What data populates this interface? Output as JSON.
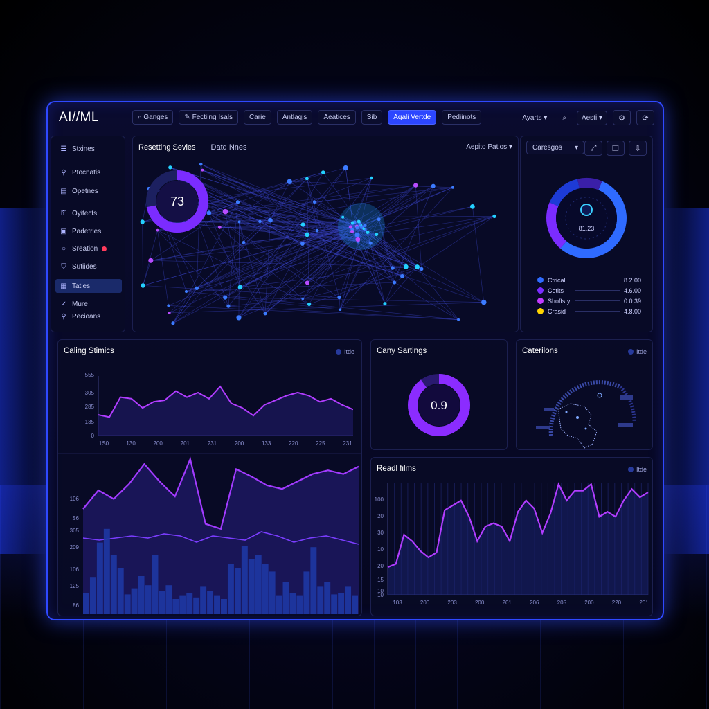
{
  "app": {
    "title": "AI//ML"
  },
  "nav": [
    {
      "label": "Ganges",
      "icon": "search-icon"
    },
    {
      "label": "Fectiing Isals",
      "icon": "pen-icon"
    },
    {
      "label": "Carie"
    },
    {
      "label": "Antlagjs"
    },
    {
      "label": "Aeatices"
    },
    {
      "label": "Sib"
    },
    {
      "label": "Aqali Vertde",
      "active": true
    },
    {
      "label": "Pediinots"
    }
  ],
  "top_right": {
    "user": "Ayarts",
    "menu": "Aesti"
  },
  "sidebar": {
    "items": [
      {
        "label": "Stxines",
        "icon": "menu-icon"
      },
      {
        "label": "Ptocnatis",
        "icon": "wand-icon"
      },
      {
        "label": "Opetnes",
        "icon": "calendar-icon"
      },
      {
        "label": "Oyitects",
        "icon": "lock-icon"
      },
      {
        "label": "Padetries",
        "icon": "folder-icon"
      },
      {
        "label": "Sreation",
        "icon": "circle-icon",
        "alert": true
      },
      {
        "label": "Sutiides",
        "icon": "shield-icon"
      },
      {
        "label": "Tatles",
        "icon": "table-icon",
        "active": true
      },
      {
        "label": "Mure",
        "icon": "check-icon"
      },
      {
        "label": "Pecioans",
        "icon": "wand-icon"
      }
    ]
  },
  "network_panel": {
    "tabs": [
      "Resetting Sevies",
      "Datd Nnes"
    ],
    "dropdown": "Aepito Patios",
    "gauge_value": "73",
    "gauge_fraction": 0.72
  },
  "donut_panel": {
    "dropdown": "Caresgos",
    "center_text": "81.23",
    "legend": [
      {
        "label": "Ctrical",
        "value": "8.2.00",
        "color": "#2f6bff"
      },
      {
        "label": "Cetits",
        "value": "4.6.00",
        "color": "#7b2cff"
      },
      {
        "label": "Shoffsty",
        "value": "0.0.39",
        "color": "#c23bff"
      },
      {
        "label": "Crasid",
        "value": "4.8.00",
        "color": "#ffd400"
      }
    ],
    "slices": [
      0.55,
      0.2,
      0.15,
      0.1
    ]
  },
  "calling": {
    "title": "Caling Stimics",
    "legend": "Itde",
    "y_ticks": [
      "0",
      "135",
      "285",
      "305",
      "555"
    ],
    "x_ticks": [
      "1S0",
      "130",
      "200",
      "201",
      "231",
      "200",
      "133",
      "220",
      "225",
      "231"
    ]
  },
  "big_chart": {
    "y_ticks": [
      "106",
      "S6",
      "305",
      "209",
      "106",
      "125",
      "86"
    ]
  },
  "settings": {
    "title": "Cany Sartings",
    "value": "0.9",
    "fraction": 0.9
  },
  "locations": {
    "title": "Caterilons",
    "legend": "Itde"
  },
  "recent": {
    "title": "Readl films",
    "legend": "Itde",
    "y_ticks": [
      "100",
      "20",
      "30",
      "10",
      "20",
      "15",
      "10",
      "10"
    ],
    "x_ticks": [
      "103",
      "200",
      "203",
      "200",
      "201",
      "206",
      "205",
      "200",
      "220",
      "201"
    ]
  },
  "chart_data": [
    {
      "type": "area",
      "title": "Caling Stimics",
      "xlabel": "",
      "ylabel": "",
      "series": [
        {
          "values": [
            135,
            120,
            250,
            240,
            180,
            220,
            230,
            290,
            250,
            280,
            240,
            320,
            210,
            180,
            130,
            200,
            230,
            260,
            280,
            260,
            220,
            240,
            200,
            170
          ]
        }
      ],
      "ylim": [
        0,
        555
      ]
    },
    {
      "type": "area",
      "title": "",
      "series": [
        {
          "values": [
            60,
            75,
            68,
            80,
            96,
            82,
            70,
            100,
            48,
            44,
            92,
            86,
            79,
            76,
            82,
            88,
            91,
            88,
            94
          ]
        },
        {
          "values": [
            30,
            29,
            30,
            31,
            30,
            32,
            31,
            28,
            31,
            30,
            29,
            33,
            31,
            28,
            30,
            31,
            29,
            27
          ]
        }
      ]
    },
    {
      "type": "bar",
      "title": "",
      "values": [
        14,
        24,
        47,
        56,
        39,
        30,
        13,
        17,
        25,
        19,
        39,
        15,
        19,
        10,
        12,
        14,
        11,
        18,
        15,
        12,
        10,
        33,
        30,
        45,
        36,
        39,
        33,
        28,
        12,
        21,
        14,
        12,
        28,
        44,
        18,
        21,
        13,
        14,
        18,
        12
      ]
    },
    {
      "type": "area",
      "title": "Readl films",
      "series": [
        {
          "values": [
            17,
            19,
            37,
            33,
            27,
            23,
            26,
            52,
            55,
            58,
            48,
            33,
            42,
            44,
            42,
            33,
            51,
            58,
            53,
            38,
            50,
            68,
            58,
            64,
            64,
            68,
            48,
            51,
            48,
            58,
            65,
            60,
            63
          ]
        }
      ],
      "ylim": [
        0,
        100
      ]
    }
  ]
}
